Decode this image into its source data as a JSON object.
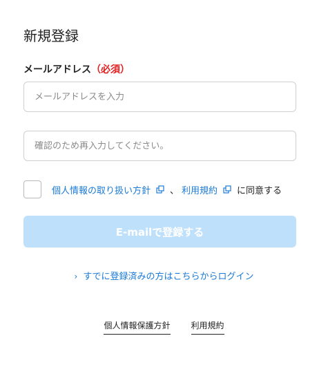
{
  "page": {
    "title": "新規登録"
  },
  "form": {
    "email_label": "メールアドレス",
    "required_mark": "（必須）",
    "email_placeholder": "メールアドレスを入力",
    "email_value": "",
    "confirm_placeholder": "確認のため再入力してください。",
    "confirm_value": "",
    "agree": {
      "privacy_link": "個人情報の取り扱い方針",
      "separator": "、",
      "terms_link": "利用規約",
      "suffix": "に同意する",
      "checked": false
    },
    "submit_label": "E-mailで登録する"
  },
  "login_link": {
    "chevron": "›",
    "label": "すでに登録済みの方はこちらからログイン"
  },
  "footer": {
    "privacy_policy": "個人情報保護方針",
    "terms": "利用規約"
  },
  "colors": {
    "link": "#1a7ad6",
    "required": "#e02020",
    "submit_disabled_bg": "#bfe0fb"
  },
  "icons": {
    "external_link": "external-link-icon"
  }
}
